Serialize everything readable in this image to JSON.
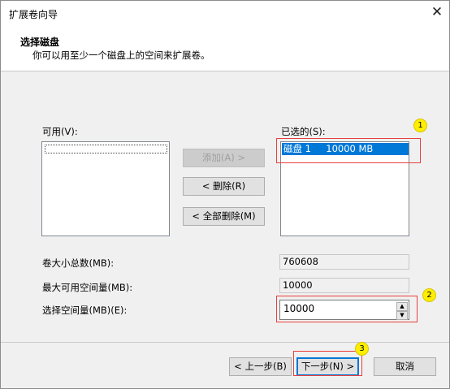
{
  "window": {
    "title": "扩展卷向导",
    "close_glyph": "✕"
  },
  "header": {
    "title": "选择磁盘",
    "subtitle": "你可以用至少一个磁盘上的空间来扩展卷。"
  },
  "available": {
    "label": "可用(V):",
    "items": []
  },
  "selected": {
    "label": "已选的(S):",
    "items": [
      "磁盘 1     10000 MB"
    ]
  },
  "buttons": {
    "add": "添加(A) >",
    "remove": "< 删除(R)",
    "remove_all": "< 全部删除(M)",
    "back": "< 上一步(B)",
    "next": "下一步(N) >",
    "cancel": "取消"
  },
  "fields": {
    "total_label": "卷大小总数(MB):",
    "total_value": "760608",
    "max_label": "最大可用空间量(MB):",
    "max_value": "10000",
    "amount_label": "选择空间量(MB)(E):",
    "amount_value": "10000"
  },
  "spin": {
    "up_glyph": "▲",
    "down_glyph": "▼"
  },
  "markers": [
    "1",
    "2",
    "3"
  ],
  "colors": {
    "accent": "#0078d7",
    "annotation_red": "#e8403c",
    "marker_yellow": "#ffee00"
  }
}
